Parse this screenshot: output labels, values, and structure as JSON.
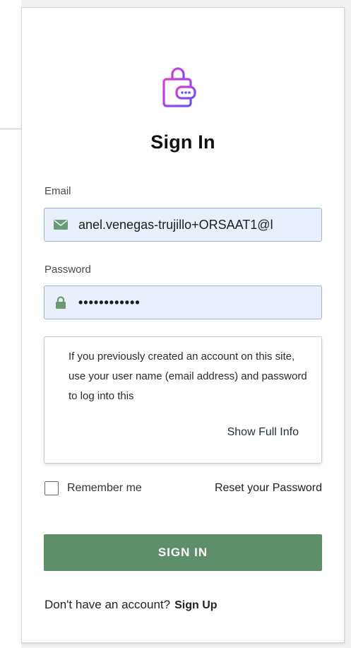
{
  "form": {
    "title": "Sign In",
    "email_label": "Email",
    "email_value": "anel.venegas-trujillo+ORSAAT1@l",
    "password_label": "Password",
    "password_value": "••••••••••••",
    "info_text": "If you previously created an account on this site, use your user name (email address) and password to log into this",
    "show_full_info": "Show Full Info",
    "remember_label": "Remember me",
    "remember_checked": false,
    "reset_password": "Reset your Password",
    "signin_button": "SIGN IN",
    "no_account_text": "Don't have an account?",
    "signup_link": "Sign Up"
  },
  "icons": {
    "logo": "wallet-lock-icon",
    "email": "envelope-icon",
    "password": "lock-icon"
  },
  "colors": {
    "accent_green": "#5f8f68",
    "field_bg": "#e9effb",
    "logo_gradient_start": "#d93ad9",
    "logo_gradient_end": "#6d4ef0"
  }
}
